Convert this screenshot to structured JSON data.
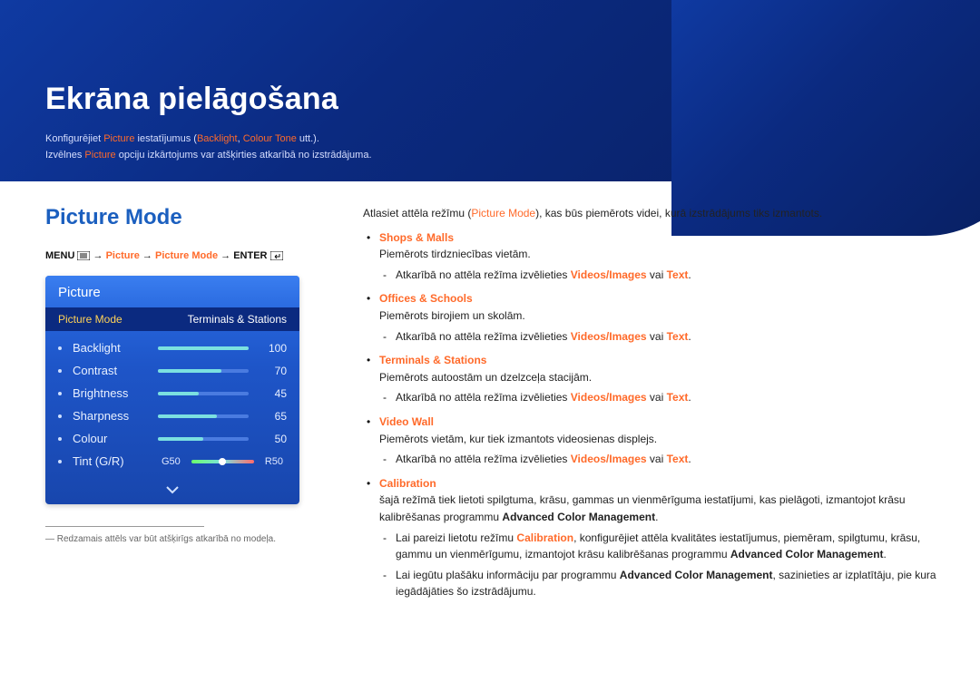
{
  "chapter": {
    "title": "Ekrāna pielāgošana",
    "sub1_pre": "Konfigurējiet ",
    "sub1_kw1": "Picture",
    "sub1_mid1": " iestatījumus (",
    "sub1_kw2": "Backlight",
    "sub1_sep": ", ",
    "sub1_kw3": "Colour Tone",
    "sub1_post": " utt.).",
    "sub2_pre": "Izvēlnes ",
    "sub2_kw": "Picture",
    "sub2_post": " opciju izkārtojums var atšķirties atkarībā no izstrādājuma."
  },
  "section": {
    "title": "Picture Mode"
  },
  "breadcrumb": {
    "menu": "MENU",
    "arrow": " → ",
    "p1": "Picture",
    "p2": "Picture Mode",
    "enter": "ENTER"
  },
  "osd": {
    "title": "Picture",
    "top_label": "Picture Mode",
    "top_value": "Terminals & Stations",
    "rows": [
      {
        "name": "Backlight",
        "value": 100,
        "pct": 100
      },
      {
        "name": "Contrast",
        "value": 70,
        "pct": 70
      },
      {
        "name": "Brightness",
        "value": 45,
        "pct": 45
      },
      {
        "name": "Sharpness",
        "value": 65,
        "pct": 65
      },
      {
        "name": "Colour",
        "value": 50,
        "pct": 50
      }
    ],
    "tint": {
      "name": "Tint (G/R)",
      "g": "G50",
      "r": "R50",
      "knob_pct": 50
    }
  },
  "footnote": "―  Redzamais attēls var būt atšķirīgs atkarībā no modeļa.",
  "right": {
    "intro_pre": "Atlasiet attēla režīmu (",
    "intro_kw": "Picture Mode",
    "intro_post": "), kas būs piemērots videi, kurā izstrādājums tiks izmantots.",
    "modes": [
      {
        "name": "Shops & Malls",
        "desc": "Piemērots tirdzniecības vietām.",
        "subs": [
          {
            "pre": "Atkarībā no attēla režīma izvēlieties ",
            "opt1": "Videos/Images",
            "mid": " vai ",
            "opt2": "Text",
            "post": "."
          }
        ]
      },
      {
        "name": "Offices & Schools",
        "desc": "Piemērots birojiem un skolām.",
        "subs": [
          {
            "pre": "Atkarībā no attēla režīma izvēlieties ",
            "opt1": "Videos/Images",
            "mid": " vai ",
            "opt2": "Text",
            "post": "."
          }
        ]
      },
      {
        "name": "Terminals & Stations",
        "desc": "Piemērots autoostām un dzelzceļa stacijām.",
        "subs": [
          {
            "pre": "Atkarībā no attēla režīma izvēlieties ",
            "opt1": "Videos/Images",
            "mid": " vai ",
            "opt2": "Text",
            "post": "."
          }
        ]
      },
      {
        "name": "Video Wall",
        "desc": "Piemērots vietām, kur tiek izmantots videosienas displejs.",
        "subs": [
          {
            "pre": "Atkarībā no attēla režīma izvēlieties ",
            "opt1": "Videos/Images",
            "mid": " vai ",
            "opt2": "Text",
            "post": "."
          }
        ]
      }
    ],
    "calibration": {
      "name": "Calibration",
      "desc_pre": "šajā režīmā tiek lietoti spilgtuma, krāsu, gammas un vienmērīguma iestatījumi, kas pielāgoti, izmantojot krāsu kalibrēšanas programmu ",
      "desc_bold": "Advanced Color Management",
      "desc_post": ".",
      "subs": [
        {
          "pre": "Lai pareizi lietotu režīmu ",
          "kw": "Calibration",
          "mid": ", konfigurējiet attēla kvalitātes iestatījumus, piemēram, spilgtumu, krāsu, gammu un vienmērīgumu, izmantojot krāsu kalibrēšanas programmu ",
          "bold": "Advanced Color Management",
          "post": "."
        },
        {
          "pre": "Lai iegūtu plašāku informāciju par programmu ",
          "bold": "Advanced Color Management",
          "post": ", sazinieties ar izplatītāju, pie kura iegādājāties šo izstrādājumu."
        }
      ]
    }
  }
}
